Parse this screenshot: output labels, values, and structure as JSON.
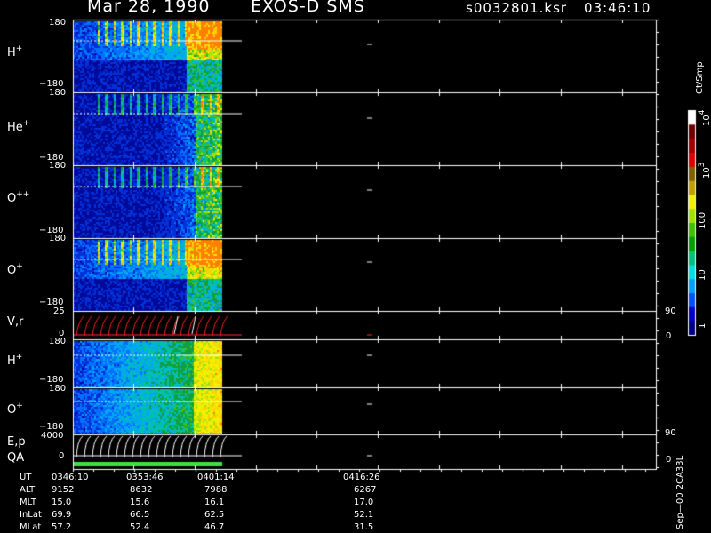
{
  "header": {
    "date": "Mar 28, 1990",
    "instrument": "EXOS-D SMS",
    "file": "s0032801.ksr",
    "time": "03:46:10"
  },
  "panels": [
    {
      "label": "H",
      "charge": "+",
      "ymax": "180",
      "ymin": "−180"
    },
    {
      "label": "He",
      "charge": "+",
      "ymax": "180",
      "ymin": "−180"
    },
    {
      "label": "O",
      "charge": "++",
      "ymax": "180",
      "ymin": "−180"
    },
    {
      "label": "O",
      "charge": "+",
      "ymax": "180",
      "ymin": "−180"
    },
    {
      "label": "V,r",
      "charge": "",
      "ymax": "25",
      "ymin": "0",
      "right_top": "90",
      "right_bottom": "0"
    },
    {
      "label": "H",
      "charge": "+",
      "ymax": "180",
      "ymin": "−180"
    },
    {
      "label": "O",
      "charge": "+",
      "ymax": "180",
      "ymin": "−180"
    },
    {
      "label": "E,p",
      "label2": "QA",
      "charge": "",
      "ymax": "4000",
      "ymin": "0",
      "right_top": "90",
      "right_bottom": "0"
    }
  ],
  "colorbar": {
    "title": "Ct/Smp",
    "ticks": [
      {
        "base": "10",
        "exp": "4"
      },
      {
        "base": "10",
        "exp": "3"
      },
      {
        "base": "100",
        "exp": ""
      },
      {
        "base": "10",
        "exp": ""
      },
      {
        "base": "1",
        "exp": ""
      }
    ],
    "colors": [
      "#000080",
      "#0000c8",
      "#0050ff",
      "#00a0ff",
      "#00e0e0",
      "#00c080",
      "#00a000",
      "#40c000",
      "#a0e000",
      "#f0f000",
      "#c0a000",
      "#806000",
      "#e00000",
      "#a00000",
      "#700000",
      "#ffffff"
    ]
  },
  "side_label": "Sep—00 2CA33L",
  "table": {
    "rows": [
      {
        "name": "UT",
        "values": [
          "0346:10",
          "0353:46",
          "0401:14",
          "0416:26"
        ]
      },
      {
        "name": "ALT",
        "values": [
          "9152",
          "8632",
          "7988",
          "6267"
        ]
      },
      {
        "name": "MLT",
        "values": [
          "15.0",
          "15.6",
          "16.1",
          "17.0"
        ]
      },
      {
        "name": "InLat",
        "values": [
          "69.9",
          "66.5",
          "62.5",
          "52.1"
        ]
      },
      {
        "name": "MLat",
        "values": [
          "57.2",
          "52.4",
          "46.7",
          "31.5"
        ]
      }
    ]
  },
  "chart_data": {
    "type": "heatmap",
    "x_ticks": [
      "0346:10",
      "0353:46",
      "0401:14",
      "0416:26"
    ],
    "data_coverage": "0346:10 to 0401:14",
    "y_axis": "pitch angle, -180 to 180",
    "color_scale": "log, 1 to 10^4 Ct/Smp"
  }
}
